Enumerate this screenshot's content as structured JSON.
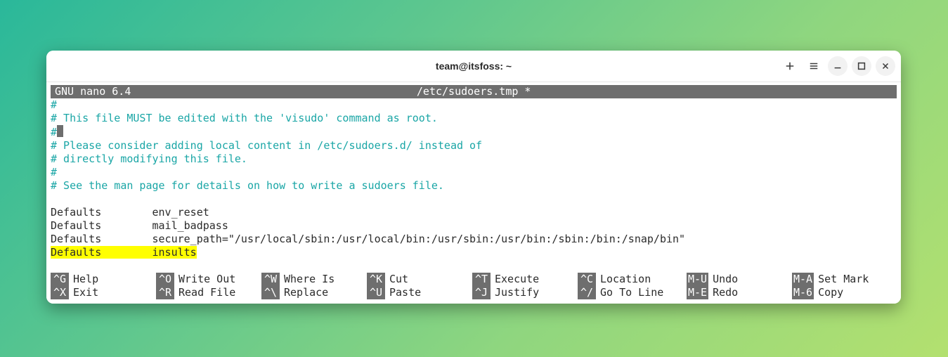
{
  "titlebar": {
    "title": "team@itsfoss: ~"
  },
  "nano": {
    "app": "GNU nano 6.4",
    "file": "/etc/sudoers.tmp *",
    "comments": [
      "#",
      "# This file MUST be edited with the 'visudo' command as root.",
      "#",
      "# Please consider adding local content in /etc/sudoers.d/ instead of",
      "# directly modifying this file.",
      "#",
      "# See the man page for details on how to write a sudoers file."
    ],
    "body": [
      "Defaults        env_reset",
      "Defaults        mail_badpass",
      "Defaults        secure_path=\"/usr/local/sbin:/usr/local/bin:/usr/sbin:/usr/bin:/sbin:/bin:/snap/bin\""
    ],
    "highlighted": "Defaults        insults"
  },
  "shortcuts": [
    {
      "key": "^G",
      "label": "Help"
    },
    {
      "key": "^O",
      "label": "Write Out"
    },
    {
      "key": "^W",
      "label": "Where Is"
    },
    {
      "key": "^K",
      "label": "Cut"
    },
    {
      "key": "^T",
      "label": "Execute"
    },
    {
      "key": "^C",
      "label": "Location"
    },
    {
      "key": "M-U",
      "label": "Undo"
    },
    {
      "key": "M-A",
      "label": "Set Mark"
    },
    {
      "key": "^X",
      "label": "Exit"
    },
    {
      "key": "^R",
      "label": "Read File"
    },
    {
      "key": "^\\",
      "label": "Replace"
    },
    {
      "key": "^U",
      "label": "Paste"
    },
    {
      "key": "^J",
      "label": "Justify"
    },
    {
      "key": "^/",
      "label": "Go To Line"
    },
    {
      "key": "M-E",
      "label": "Redo"
    },
    {
      "key": "M-6",
      "label": "Copy"
    }
  ]
}
